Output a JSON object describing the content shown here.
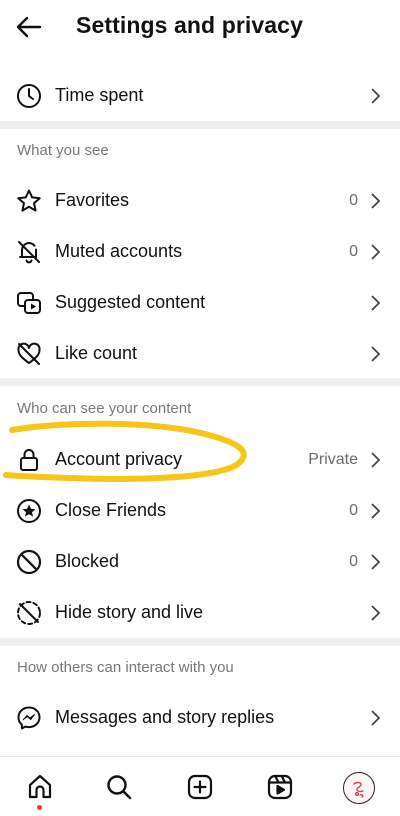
{
  "header": {
    "title": "Settings and privacy",
    "back_icon": "arrow-left-icon"
  },
  "top_items": [
    {
      "label": "Time spent",
      "icon": "clock-icon"
    }
  ],
  "sections": [
    {
      "title": "What you see",
      "items": [
        {
          "label": "Favorites",
          "value": "0",
          "icon": "star-icon"
        },
        {
          "label": "Muted accounts",
          "value": "0",
          "icon": "bell-off-icon"
        },
        {
          "label": "Suggested content",
          "value": "",
          "icon": "suggested-content-icon"
        },
        {
          "label": "Like count",
          "value": "",
          "icon": "heart-off-icon"
        }
      ]
    },
    {
      "title": "Who can see your content",
      "items": [
        {
          "label": "Account privacy",
          "value": "Private",
          "icon": "lock-icon"
        },
        {
          "label": "Close Friends",
          "value": "0",
          "icon": "close-friends-star-icon"
        },
        {
          "label": "Blocked",
          "value": "0",
          "icon": "blocked-icon"
        },
        {
          "label": "Hide story and live",
          "value": "",
          "icon": "hide-story-icon"
        }
      ]
    },
    {
      "title": "How others can interact with you",
      "items": [
        {
          "label": "Messages and story replies",
          "value": "",
          "icon": "messenger-icon"
        }
      ]
    }
  ],
  "annotation": {
    "color": "#f5c518"
  },
  "bottom_nav": [
    {
      "name": "home",
      "icon": "home-icon",
      "active": true
    },
    {
      "name": "search",
      "icon": "search-icon"
    },
    {
      "name": "create",
      "icon": "plus-square-icon"
    },
    {
      "name": "reels",
      "icon": "reels-icon"
    },
    {
      "name": "profile",
      "icon": "avatar"
    }
  ],
  "colors": {
    "text": "#111111",
    "muted": "#6b6b6b",
    "divider": "#efefef",
    "notification_dot": "#ff3040"
  }
}
